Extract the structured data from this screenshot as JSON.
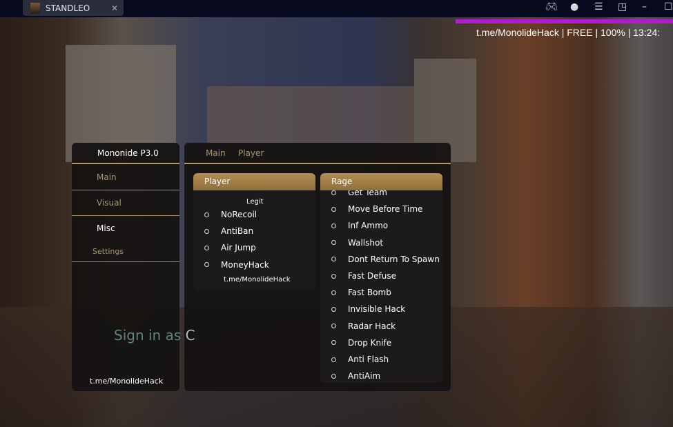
{
  "window": {
    "tab_title": "STANDLEO",
    "icons": [
      "gamepad-icon",
      "account-icon",
      "menu-icon",
      "pin-icon",
      "minimize-icon",
      "maximize-icon"
    ]
  },
  "background": {
    "sign_in_prefix": "Sign in as",
    "sign_in_suffix": "C"
  },
  "watermark": {
    "text": "t.me/MonolideHack | FREE  | 100% | 13:24:",
    "bar_color": "#b01ad0"
  },
  "sidebar": {
    "title": "Mononide P3.0",
    "items": [
      {
        "label": "Main"
      },
      {
        "label": "Visual"
      },
      {
        "label": "Misc"
      },
      {
        "label": "Settings"
      }
    ],
    "footer": "t.me/MonolideHack"
  },
  "main": {
    "tabs": [
      {
        "label": "Main"
      },
      {
        "label": "Player"
      }
    ],
    "player_card": {
      "title": "Player",
      "section": "Legit",
      "items": [
        "NoRecoil",
        "AntiBan",
        "Air Jump",
        "MoneyHack"
      ],
      "footer": "t.me/MonolideHack"
    },
    "rage_card": {
      "title": "Rage",
      "items": [
        "Get Team",
        "Move Before Time",
        "Inf Ammo",
        "Wallshot",
        "Dont Return To Spawn",
        "Fast Defuse",
        "Fast Bomb",
        "Invisible Hack",
        "Radar Hack",
        "Drop Knife",
        "Anti Flash",
        "AntiAim"
      ]
    }
  },
  "accent": "#b38f52"
}
